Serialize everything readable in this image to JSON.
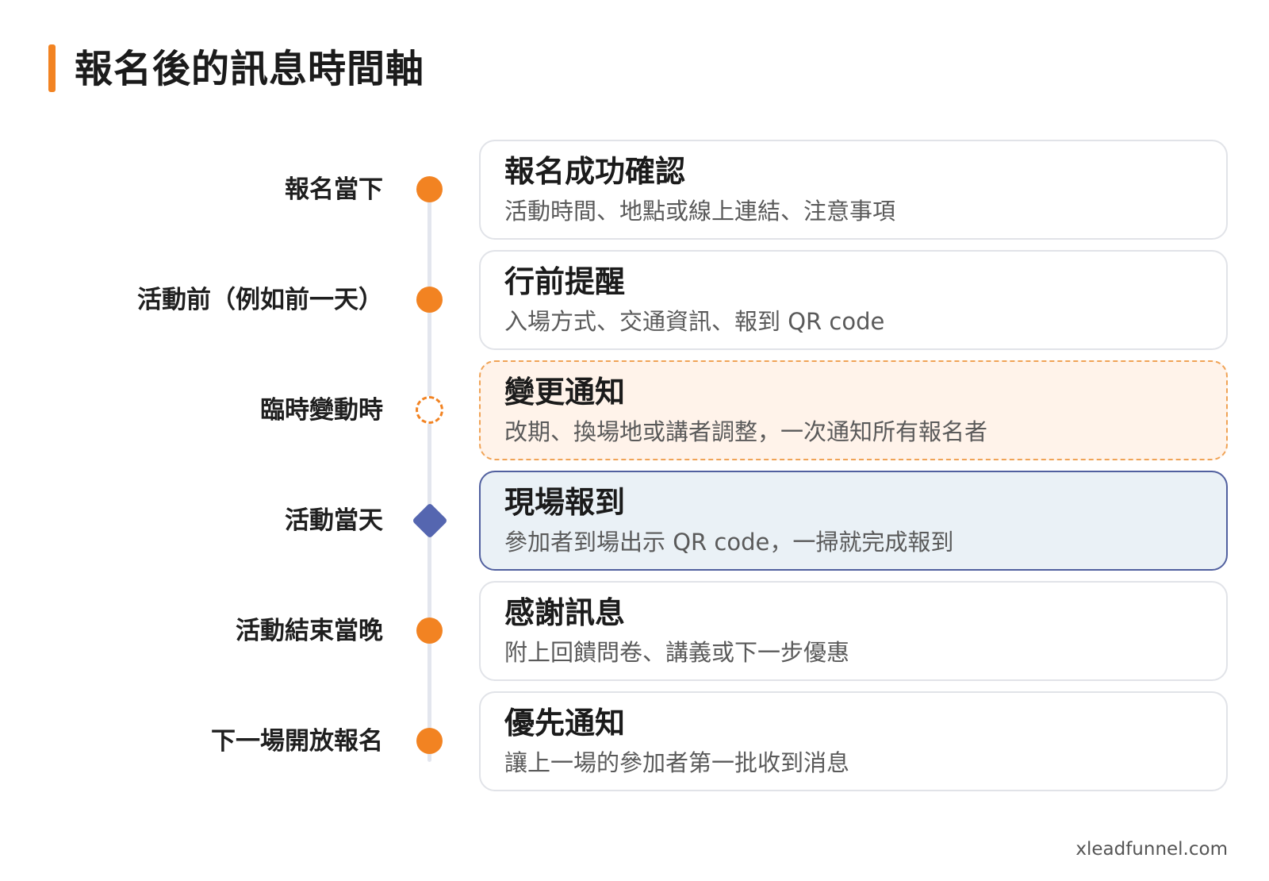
{
  "page": {
    "title": "報名後的訊息時間軸",
    "footer": "xleadfunnel.com",
    "accent_color": "#f28322",
    "highlight_color": "#5566b0"
  },
  "timeline": [
    {
      "stage": "報名當下",
      "marker": "filled-dot",
      "title": "報名成功確認",
      "desc": "活動時間、地點或線上連結、注意事項"
    },
    {
      "stage": "活動前（例如前一天）",
      "marker": "filled-dot",
      "title": "行前提醒",
      "desc": "入場方式、交通資訊、報到 QR code"
    },
    {
      "stage": "臨時變動時",
      "marker": "dashed-circle",
      "title": "變更通知",
      "desc": "改期、換場地或講者調整，一次通知所有報名者"
    },
    {
      "stage": "活動當天",
      "marker": "diamond",
      "title": "現場報到",
      "desc": "參加者到場出示 QR code，一掃就完成報到"
    },
    {
      "stage": "活動結束當晚",
      "marker": "filled-dot",
      "title": "感謝訊息",
      "desc": "附上回饋問卷、講義或下一步優惠"
    },
    {
      "stage": "下一場開放報名",
      "marker": "filled-dot",
      "title": "優先通知",
      "desc": "讓上一場的參加者第一批收到消息"
    }
  ]
}
